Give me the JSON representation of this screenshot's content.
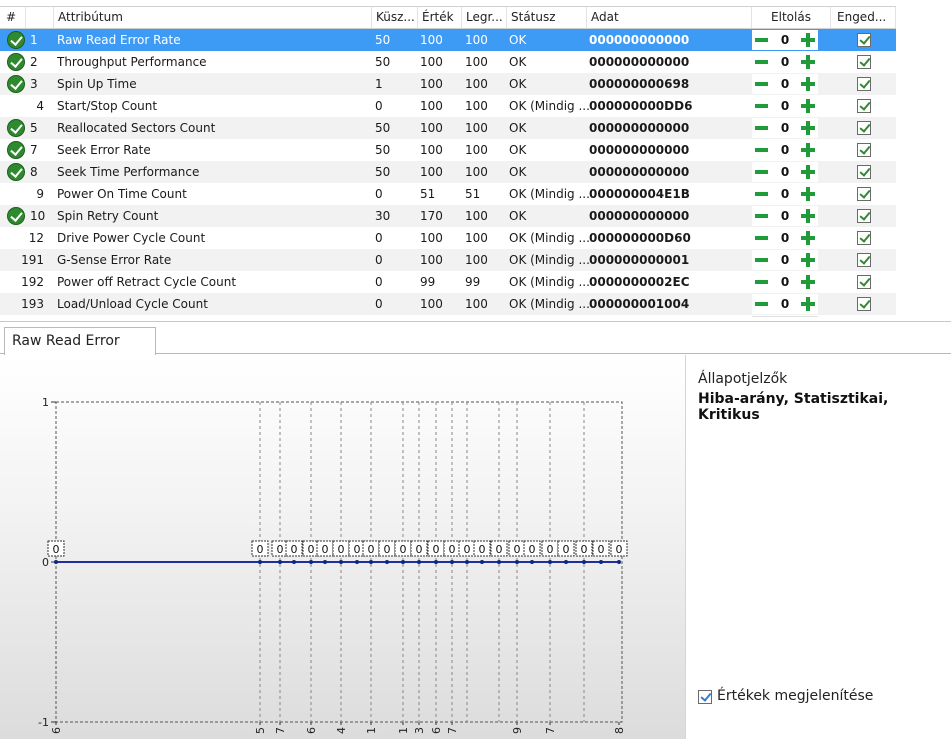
{
  "table": {
    "columns": {
      "num": "#",
      "attr": "Attribútum",
      "thresh": "Küsz...",
      "value": "Érték",
      "worst": "Legr...",
      "status": "Státusz",
      "data": "Adat",
      "offset": "Eltolás",
      "enabled": "Enged..."
    },
    "rows": [
      {
        "ok": true,
        "id": "1",
        "name": "Raw Read Error Rate",
        "thresh": "50",
        "value": "100",
        "worst": "100",
        "status": "OK",
        "data": "000000000000",
        "offset": "0",
        "enabled": true,
        "selected": true
      },
      {
        "ok": true,
        "id": "2",
        "name": "Throughput Performance",
        "thresh": "50",
        "value": "100",
        "worst": "100",
        "status": "OK",
        "data": "000000000000",
        "offset": "0",
        "enabled": true
      },
      {
        "ok": true,
        "id": "3",
        "name": "Spin Up Time",
        "thresh": "1",
        "value": "100",
        "worst": "100",
        "status": "OK",
        "data": "000000000698",
        "offset": "0",
        "enabled": true
      },
      {
        "ok": false,
        "id": "4",
        "name": "Start/Stop Count",
        "thresh": "0",
        "value": "100",
        "worst": "100",
        "status": "OK (Mindig ...",
        "data": "000000000DD6",
        "offset": "0",
        "enabled": true
      },
      {
        "ok": true,
        "id": "5",
        "name": "Reallocated Sectors Count",
        "thresh": "50",
        "value": "100",
        "worst": "100",
        "status": "OK",
        "data": "000000000000",
        "offset": "0",
        "enabled": true
      },
      {
        "ok": true,
        "id": "7",
        "name": "Seek Error Rate",
        "thresh": "50",
        "value": "100",
        "worst": "100",
        "status": "OK",
        "data": "000000000000",
        "offset": "0",
        "enabled": true
      },
      {
        "ok": true,
        "id": "8",
        "name": "Seek Time Performance",
        "thresh": "50",
        "value": "100",
        "worst": "100",
        "status": "OK",
        "data": "000000000000",
        "offset": "0",
        "enabled": true
      },
      {
        "ok": false,
        "id": "9",
        "name": "Power On Time Count",
        "thresh": "0",
        "value": "51",
        "worst": "51",
        "status": "OK (Mindig ...",
        "data": "000000004E1B",
        "offset": "0",
        "enabled": true
      },
      {
        "ok": true,
        "id": "10",
        "name": "Spin Retry Count",
        "thresh": "30",
        "value": "170",
        "worst": "100",
        "status": "OK",
        "data": "000000000000",
        "offset": "0",
        "enabled": true
      },
      {
        "ok": false,
        "id": "12",
        "name": "Drive Power Cycle Count",
        "thresh": "0",
        "value": "100",
        "worst": "100",
        "status": "OK (Mindig ...",
        "data": "000000000D60",
        "offset": "0",
        "enabled": true
      },
      {
        "ok": false,
        "id": "191",
        "name": "G-Sense Error Rate",
        "thresh": "0",
        "value": "100",
        "worst": "100",
        "status": "OK (Mindig ...",
        "data": "000000000001",
        "offset": "0",
        "enabled": true
      },
      {
        "ok": false,
        "id": "192",
        "name": "Power off Retract Cycle Count",
        "thresh": "0",
        "value": "99",
        "worst": "99",
        "status": "OK (Mindig ...",
        "data": "0000000002EC",
        "offset": "0",
        "enabled": true
      },
      {
        "ok": false,
        "id": "193",
        "name": "Load/Unload Cycle Count",
        "thresh": "0",
        "value": "100",
        "worst": "100",
        "status": "OK (Mindig ...",
        "data": "000000001004",
        "offset": "0",
        "enabled": true
      }
    ]
  },
  "detail": {
    "tab_label": "Raw Read Error Rate",
    "state_heading": "Állapotjelzők",
    "state_values": "Hiba-arány, Statisztikai, Kritikus",
    "show_values_label": "Értékek megjelenítése",
    "show_values_checked": true
  },
  "colors": {
    "selection": "#3d9bf5",
    "ok_icon": "#2f8a2f",
    "stepper_green": "#1f9b3a",
    "series_line": "#1f2f9f"
  },
  "chart_data": {
    "type": "line",
    "title": "",
    "xlabel": "",
    "ylabel": "",
    "ylim": [
      -1,
      1
    ],
    "y_ticks": [
      "1",
      "0",
      "-1"
    ],
    "x_tick_labels": [
      "6",
      "5",
      "7",
      "6",
      "4",
      "1",
      "1",
      "3",
      "6",
      "7",
      "9",
      "7",
      "8"
    ],
    "series": [
      {
        "values": [
          0,
          0,
          0,
          0,
          0,
          0,
          0,
          0,
          0,
          0,
          0,
          0,
          0,
          0,
          0,
          0,
          0,
          0,
          0,
          0,
          0,
          0,
          0,
          0,
          0
        ]
      }
    ],
    "data_labels_shown": true
  }
}
